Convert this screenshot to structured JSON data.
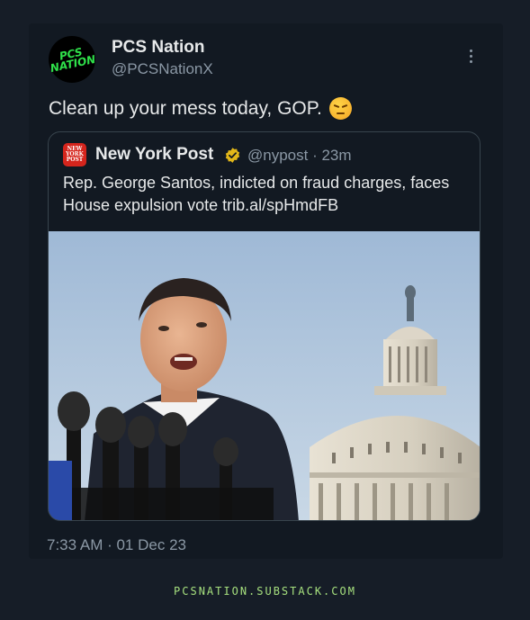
{
  "author": {
    "name": "PCS Nation",
    "handle": "@PCSNationX",
    "avatar_text": "PCS NATION"
  },
  "tweet": {
    "text": "Clean up your mess today, GOP.",
    "emoji": "angry-face"
  },
  "quoted": {
    "logo_text": "NEW YORK POST",
    "name": "New York Post",
    "handle_time": "@nypost · 23m",
    "text": "Rep. George Santos, indicted on fraud charges, faces House expulsion vote trib.al/spHmdFB",
    "image_description": "Man speaking at microphones in front of the Capitol dome"
  },
  "timestamp": "7:33 AM · 01 Dec 23",
  "watermark": "PCSNATION.SUBSTACK.COM",
  "colors": {
    "background": "#121922",
    "text": "#e7e9ea",
    "secondary": "#8b98a5",
    "verified": "#e2b719",
    "brand_red": "#d5251d",
    "watermark": "#a6e07e"
  }
}
